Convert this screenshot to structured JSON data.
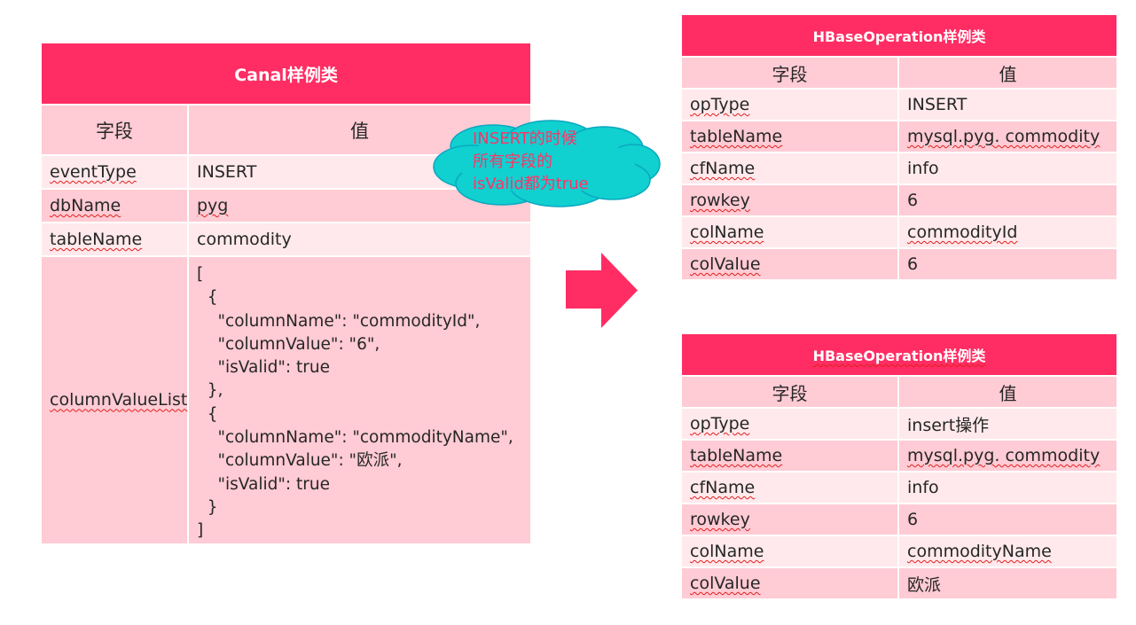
{
  "canal": {
    "title": "Canal样例类",
    "header": {
      "field": "字段",
      "value": "值"
    },
    "rows": [
      {
        "field": "eventType",
        "value": "INSERT"
      },
      {
        "field": "dbName",
        "value": "pyg"
      },
      {
        "field": "tableName",
        "value": "commodity"
      }
    ],
    "list_field": "columnValueList",
    "list_value": "[\n  {\n    \"columnName\": \"commodityId\",\n    \"columnValue\": \"6\",\n    \"isValid\": true\n  },\n  {\n    \"columnName\": \"commodityName\",\n    \"columnValue\": \"欧派\",\n    \"isValid\": true\n  }\n]"
  },
  "note": {
    "lines": [
      "INSERT的时候",
      "所有字段的",
      "isValid都为true"
    ],
    "colors": {
      "fill": "#10d0d0",
      "stroke": "#0aa8c0",
      "text": "#ff3366"
    }
  },
  "hbase_ops": [
    {
      "title": "HBaseOperation样例类",
      "header": {
        "field": "字段",
        "value": "值"
      },
      "rows": [
        {
          "field": "opType",
          "value": "INSERT"
        },
        {
          "field": "tableName",
          "value": "mysql.pyg. commodity"
        },
        {
          "field": "cfName",
          "value": "info"
        },
        {
          "field": "rowkey",
          "value": "6"
        },
        {
          "field": "colName",
          "value": "commodityId"
        },
        {
          "field": "colValue",
          "value": "6"
        }
      ]
    },
    {
      "title": "HBaseOperation样例类",
      "header": {
        "field": "字段",
        "value": "值"
      },
      "rows": [
        {
          "field": "opType",
          "value": "insert操作"
        },
        {
          "field": "tableName",
          "value": "mysql.pyg. commodity"
        },
        {
          "field": "cfName",
          "value": "info"
        },
        {
          "field": "rowkey",
          "value": "6"
        },
        {
          "field": "colName",
          "value": "commodityName"
        },
        {
          "field": "colValue",
          "value": "欧派"
        }
      ]
    }
  ],
  "colors": {
    "title_bg": "#ff2d63",
    "row_light": "#ffe9ec",
    "row_dark": "#ffcbd4",
    "arrow": "#ff2d63"
  }
}
